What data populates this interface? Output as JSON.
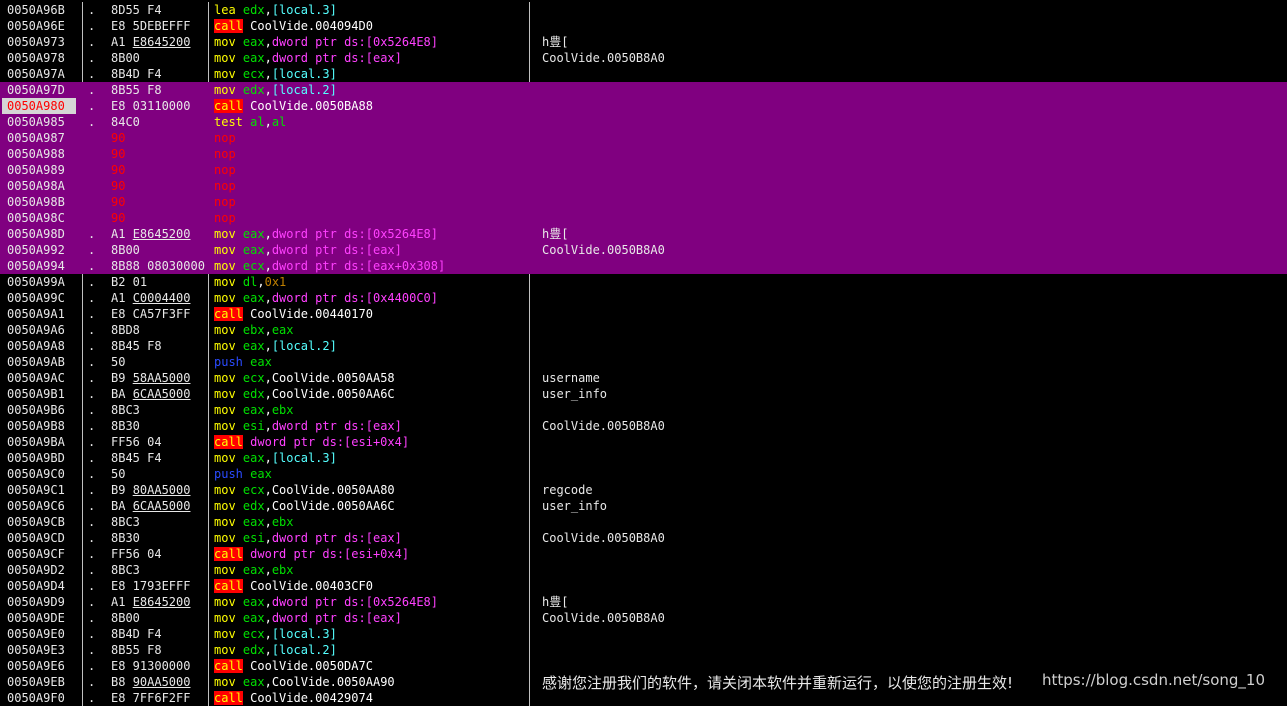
{
  "rows": [
    {
      "addr": "0050A96B",
      "mark": ".",
      "hex": [
        {
          "t": "8D55 F4"
        }
      ],
      "asm": [
        [
          "mnem",
          "lea "
        ],
        [
          "reg",
          "edx"
        ],
        [
          "txt",
          ","
        ],
        [
          "bracket",
          "[local.3]"
        ]
      ],
      "cmt": ""
    },
    {
      "addr": "0050A96E",
      "mark": ".",
      "hex": [
        {
          "t": "E8 5DEBEFFF"
        }
      ],
      "asm": [
        [
          "call",
          "call"
        ],
        [
          "txt",
          " CoolVide.004094D0"
        ]
      ],
      "cmt": ""
    },
    {
      "addr": "0050A973",
      "mark": ".",
      "hex": [
        {
          "t": "A1 "
        },
        {
          "t": "E8645200",
          "ul": true
        }
      ],
      "asm": [
        [
          "mnem",
          "mov "
        ],
        [
          "reg",
          "eax"
        ],
        [
          "txt",
          ","
        ],
        [
          "ptr",
          "dword ptr ds:[0x5264E8]"
        ]
      ],
      "cmt": "h豊[ "
    },
    {
      "addr": "0050A978",
      "mark": ".",
      "hex": [
        {
          "t": "8B00"
        }
      ],
      "asm": [
        [
          "mnem",
          "mov "
        ],
        [
          "reg",
          "eax"
        ],
        [
          "txt",
          ","
        ],
        [
          "ptr",
          "dword ptr ds:[eax]"
        ]
      ],
      "cmt": "CoolVide.0050B8A0"
    },
    {
      "addr": "0050A97A",
      "mark": ".",
      "hex": [
        {
          "t": "8B4D F4"
        }
      ],
      "asm": [
        [
          "mnem",
          "mov "
        ],
        [
          "reg",
          "ecx"
        ],
        [
          "txt",
          ","
        ],
        [
          "bracket",
          "[local.3]"
        ]
      ],
      "cmt": ""
    },
    {
      "addr": "0050A97D",
      "mark": ".",
      "sel": true,
      "hex": [
        {
          "t": "8B55 F8"
        }
      ],
      "asm": [
        [
          "mnem",
          "mov "
        ],
        [
          "reg",
          "edx"
        ],
        [
          "txt",
          ","
        ],
        [
          "bracket",
          "[local.2]"
        ]
      ],
      "cmt": ""
    },
    {
      "addr": "0050A980",
      "mark": ".",
      "sel": true,
      "cur": true,
      "hex": [
        {
          "t": "E8 03110000"
        }
      ],
      "asm": [
        [
          "call",
          "call"
        ],
        [
          "txt",
          " CoolVide.0050BA88"
        ]
      ],
      "cmt": ""
    },
    {
      "addr": "0050A985",
      "mark": ".",
      "sel": true,
      "hex": [
        {
          "t": "84C0"
        }
      ],
      "asm": [
        [
          "mnem",
          "test "
        ],
        [
          "reg",
          "al"
        ],
        [
          "txt",
          ","
        ],
        [
          "reg",
          "al"
        ]
      ],
      "cmt": ""
    },
    {
      "addr": "0050A987",
      "mark": "",
      "sel": true,
      "hex": [
        {
          "t": "90",
          "red": true
        }
      ],
      "asm": [
        [
          "nop",
          "nop"
        ]
      ],
      "cmt": ""
    },
    {
      "addr": "0050A988",
      "mark": "",
      "sel": true,
      "hex": [
        {
          "t": "90",
          "red": true
        }
      ],
      "asm": [
        [
          "nop",
          "nop"
        ]
      ],
      "cmt": ""
    },
    {
      "addr": "0050A989",
      "mark": "",
      "sel": true,
      "hex": [
        {
          "t": "90",
          "red": true
        }
      ],
      "asm": [
        [
          "nop",
          "nop"
        ]
      ],
      "cmt": ""
    },
    {
      "addr": "0050A98A",
      "mark": "",
      "sel": true,
      "hex": [
        {
          "t": "90",
          "red": true
        }
      ],
      "asm": [
        [
          "nop",
          "nop"
        ]
      ],
      "cmt": ""
    },
    {
      "addr": "0050A98B",
      "mark": "",
      "sel": true,
      "hex": [
        {
          "t": "90",
          "red": true
        }
      ],
      "asm": [
        [
          "nop",
          "nop"
        ]
      ],
      "cmt": ""
    },
    {
      "addr": "0050A98C",
      "mark": "",
      "sel": true,
      "hex": [
        {
          "t": "90",
          "red": true
        }
      ],
      "asm": [
        [
          "nop",
          "nop"
        ]
      ],
      "cmt": ""
    },
    {
      "addr": "0050A98D",
      "mark": ".",
      "sel": true,
      "hex": [
        {
          "t": "A1 "
        },
        {
          "t": "E8645200",
          "ul": true
        }
      ],
      "asm": [
        [
          "mnem",
          "mov "
        ],
        [
          "reg",
          "eax"
        ],
        [
          "txt",
          ","
        ],
        [
          "ptr",
          "dword ptr ds:[0x5264E8]"
        ]
      ],
      "cmt": "h豊[ "
    },
    {
      "addr": "0050A992",
      "mark": ".",
      "sel": true,
      "hex": [
        {
          "t": "8B00"
        }
      ],
      "asm": [
        [
          "mnem",
          "mov "
        ],
        [
          "reg",
          "eax"
        ],
        [
          "txt",
          ","
        ],
        [
          "ptr",
          "dword ptr ds:[eax]"
        ]
      ],
      "cmt": "CoolVide.0050B8A0"
    },
    {
      "addr": "0050A994",
      "mark": ".",
      "sel": true,
      "hex": [
        {
          "t": "8B88 08030000"
        }
      ],
      "asm": [
        [
          "mnem",
          "mov "
        ],
        [
          "reg",
          "ecx"
        ],
        [
          "txt",
          ","
        ],
        [
          "ptr",
          "dword ptr ds:[eax+0x308]"
        ]
      ],
      "cmt": ""
    },
    {
      "addr": "0050A99A",
      "mark": ".",
      "hex": [
        {
          "t": "B2 01"
        }
      ],
      "asm": [
        [
          "mnem",
          "mov "
        ],
        [
          "reg",
          "dl"
        ],
        [
          "txt",
          ","
        ],
        [
          "num",
          "0x1"
        ]
      ],
      "cmt": ""
    },
    {
      "addr": "0050A99C",
      "mark": ".",
      "hex": [
        {
          "t": "A1 "
        },
        {
          "t": "C0004400",
          "ul": true
        }
      ],
      "asm": [
        [
          "mnem",
          "mov "
        ],
        [
          "reg",
          "eax"
        ],
        [
          "txt",
          ","
        ],
        [
          "ptr",
          "dword ptr ds:[0x4400C0]"
        ]
      ],
      "cmt": ""
    },
    {
      "addr": "0050A9A1",
      "mark": ".",
      "hex": [
        {
          "t": "E8 CA57F3FF"
        }
      ],
      "asm": [
        [
          "call",
          "call"
        ],
        [
          "txt",
          " CoolVide.00440170"
        ]
      ],
      "cmt": ""
    },
    {
      "addr": "0050A9A6",
      "mark": ".",
      "hex": [
        {
          "t": "8BD8"
        }
      ],
      "asm": [
        [
          "mnem",
          "mov "
        ],
        [
          "reg",
          "ebx"
        ],
        [
          "txt",
          ","
        ],
        [
          "reg",
          "eax"
        ]
      ],
      "cmt": ""
    },
    {
      "addr": "0050A9A8",
      "mark": ".",
      "hex": [
        {
          "t": "8B45 F8"
        }
      ],
      "asm": [
        [
          "mnem",
          "mov "
        ],
        [
          "reg",
          "eax"
        ],
        [
          "txt",
          ","
        ],
        [
          "bracket",
          "[local.2]"
        ]
      ],
      "cmt": ""
    },
    {
      "addr": "0050A9AB",
      "mark": ".",
      "hex": [
        {
          "t": "50"
        }
      ],
      "asm": [
        [
          "push",
          "push "
        ],
        [
          "reg",
          "eax"
        ]
      ],
      "cmt": ""
    },
    {
      "addr": "0050A9AC",
      "mark": ".",
      "hex": [
        {
          "t": "B9 "
        },
        {
          "t": "58AA5000",
          "ul": true
        }
      ],
      "asm": [
        [
          "mnem",
          "mov "
        ],
        [
          "reg",
          "ecx"
        ],
        [
          "txt",
          ",CoolVide.0050AA58"
        ]
      ],
      "cmt": "username"
    },
    {
      "addr": "0050A9B1",
      "mark": ".",
      "hex": [
        {
          "t": "BA "
        },
        {
          "t": "6CAA5000",
          "ul": true
        }
      ],
      "asm": [
        [
          "mnem",
          "mov "
        ],
        [
          "reg",
          "edx"
        ],
        [
          "txt",
          ",CoolVide.0050AA6C"
        ]
      ],
      "cmt": "user_info"
    },
    {
      "addr": "0050A9B6",
      "mark": ".",
      "hex": [
        {
          "t": "8BC3"
        }
      ],
      "asm": [
        [
          "mnem",
          "mov "
        ],
        [
          "reg",
          "eax"
        ],
        [
          "txt",
          ","
        ],
        [
          "reg",
          "ebx"
        ]
      ],
      "cmt": ""
    },
    {
      "addr": "0050A9B8",
      "mark": ".",
      "hex": [
        {
          "t": "8B30"
        }
      ],
      "asm": [
        [
          "mnem",
          "mov "
        ],
        [
          "reg",
          "esi"
        ],
        [
          "txt",
          ","
        ],
        [
          "ptr",
          "dword ptr ds:[eax]"
        ]
      ],
      "cmt": "CoolVide.0050B8A0"
    },
    {
      "addr": "0050A9BA",
      "mark": ".",
      "hex": [
        {
          "t": "FF56 04"
        }
      ],
      "asm": [
        [
          "call",
          "call"
        ],
        [
          "txt",
          " "
        ],
        [
          "ptr",
          "dword ptr ds:[esi+0x4]"
        ]
      ],
      "cmt": ""
    },
    {
      "addr": "0050A9BD",
      "mark": ".",
      "hex": [
        {
          "t": "8B45 F4"
        }
      ],
      "asm": [
        [
          "mnem",
          "mov "
        ],
        [
          "reg",
          "eax"
        ],
        [
          "txt",
          ","
        ],
        [
          "bracket",
          "[local.3]"
        ]
      ],
      "cmt": ""
    },
    {
      "addr": "0050A9C0",
      "mark": ".",
      "hex": [
        {
          "t": "50"
        }
      ],
      "asm": [
        [
          "push",
          "push "
        ],
        [
          "reg",
          "eax"
        ]
      ],
      "cmt": ""
    },
    {
      "addr": "0050A9C1",
      "mark": ".",
      "hex": [
        {
          "t": "B9 "
        },
        {
          "t": "80AA5000",
          "ul": true
        }
      ],
      "asm": [
        [
          "mnem",
          "mov "
        ],
        [
          "reg",
          "ecx"
        ],
        [
          "txt",
          ",CoolVide.0050AA80"
        ]
      ],
      "cmt": "regcode"
    },
    {
      "addr": "0050A9C6",
      "mark": ".",
      "hex": [
        {
          "t": "BA "
        },
        {
          "t": "6CAA5000",
          "ul": true
        }
      ],
      "asm": [
        [
          "mnem",
          "mov "
        ],
        [
          "reg",
          "edx"
        ],
        [
          "txt",
          ",CoolVide.0050AA6C"
        ]
      ],
      "cmt": "user_info"
    },
    {
      "addr": "0050A9CB",
      "mark": ".",
      "hex": [
        {
          "t": "8BC3"
        }
      ],
      "asm": [
        [
          "mnem",
          "mov "
        ],
        [
          "reg",
          "eax"
        ],
        [
          "txt",
          ","
        ],
        [
          "reg",
          "ebx"
        ]
      ],
      "cmt": ""
    },
    {
      "addr": "0050A9CD",
      "mark": ".",
      "hex": [
        {
          "t": "8B30"
        }
      ],
      "asm": [
        [
          "mnem",
          "mov "
        ],
        [
          "reg",
          "esi"
        ],
        [
          "txt",
          ","
        ],
        [
          "ptr",
          "dword ptr ds:[eax]"
        ]
      ],
      "cmt": "CoolVide.0050B8A0"
    },
    {
      "addr": "0050A9CF",
      "mark": ".",
      "hex": [
        {
          "t": "FF56 04"
        }
      ],
      "asm": [
        [
          "call",
          "call"
        ],
        [
          "txt",
          " "
        ],
        [
          "ptr",
          "dword ptr ds:[esi+0x4]"
        ]
      ],
      "cmt": ""
    },
    {
      "addr": "0050A9D2",
      "mark": ".",
      "hex": [
        {
          "t": "8BC3"
        }
      ],
      "asm": [
        [
          "mnem",
          "mov "
        ],
        [
          "reg",
          "eax"
        ],
        [
          "txt",
          ","
        ],
        [
          "reg",
          "ebx"
        ]
      ],
      "cmt": ""
    },
    {
      "addr": "0050A9D4",
      "mark": ".",
      "hex": [
        {
          "t": "E8 1793EFFF"
        }
      ],
      "asm": [
        [
          "call",
          "call"
        ],
        [
          "txt",
          " CoolVide.00403CF0"
        ]
      ],
      "cmt": ""
    },
    {
      "addr": "0050A9D9",
      "mark": ".",
      "hex": [
        {
          "t": "A1 "
        },
        {
          "t": "E8645200",
          "ul": true
        }
      ],
      "asm": [
        [
          "mnem",
          "mov "
        ],
        [
          "reg",
          "eax"
        ],
        [
          "txt",
          ","
        ],
        [
          "ptr",
          "dword ptr ds:[0x5264E8]"
        ]
      ],
      "cmt": "h豊[ "
    },
    {
      "addr": "0050A9DE",
      "mark": ".",
      "hex": [
        {
          "t": "8B00"
        }
      ],
      "asm": [
        [
          "mnem",
          "mov "
        ],
        [
          "reg",
          "eax"
        ],
        [
          "txt",
          ","
        ],
        [
          "ptr",
          "dword ptr ds:[eax]"
        ]
      ],
      "cmt": "CoolVide.0050B8A0"
    },
    {
      "addr": "0050A9E0",
      "mark": ".",
      "hex": [
        {
          "t": "8B4D F4"
        }
      ],
      "asm": [
        [
          "mnem",
          "mov "
        ],
        [
          "reg",
          "ecx"
        ],
        [
          "txt",
          ","
        ],
        [
          "bracket",
          "[local.3]"
        ]
      ],
      "cmt": ""
    },
    {
      "addr": "0050A9E3",
      "mark": ".",
      "hex": [
        {
          "t": "8B55 F8"
        }
      ],
      "asm": [
        [
          "mnem",
          "mov "
        ],
        [
          "reg",
          "edx"
        ],
        [
          "txt",
          ","
        ],
        [
          "bracket",
          "[local.2]"
        ]
      ],
      "cmt": ""
    },
    {
      "addr": "0050A9E6",
      "mark": ".",
      "hex": [
        {
          "t": "E8 91300000"
        }
      ],
      "asm": [
        [
          "call",
          "call"
        ],
        [
          "txt",
          " CoolVide.0050DA7C"
        ]
      ],
      "cmt": ""
    },
    {
      "addr": "0050A9EB",
      "mark": ".",
      "hex": [
        {
          "t": "B8 "
        },
        {
          "t": "90AA5000",
          "ul": true
        }
      ],
      "asm": [
        [
          "mnem",
          "mov "
        ],
        [
          "reg",
          "eax"
        ],
        [
          "txt",
          ",CoolVide.0050AA90"
        ]
      ],
      "cmt": ""
    },
    {
      "addr": "0050A9F0",
      "mark": ".",
      "hex": [
        {
          "t": "E8 7FF6F2FF"
        }
      ],
      "asm": [
        [
          "call",
          "call"
        ],
        [
          "txt",
          " CoolVide.00429074"
        ]
      ],
      "cmt": ""
    }
  ],
  "footer_message": "感谢您注册我们的软件，请关闭本软件并重新运行，以使您的注册生效!",
  "watermark": "https://blog.csdn.net/song_10",
  "colors": {
    "selection": "#800080",
    "background": "#000000",
    "call_bg": "#ff0000"
  }
}
